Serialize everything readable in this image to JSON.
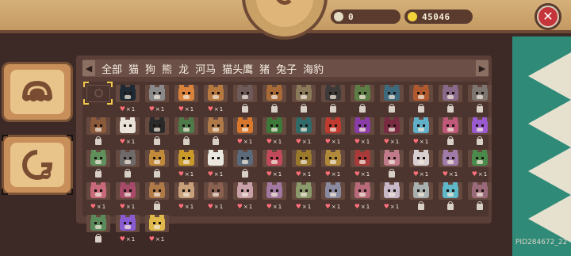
{
  "currency": {
    "gems": "0",
    "coins": "45046",
    "gem_color": "#e3dcc2",
    "coin_color": "#f2d13b"
  },
  "filters": [
    "全部",
    "猫",
    "狗",
    "熊",
    "龙",
    "河马",
    "猫头鹰",
    "猪",
    "兔子",
    "海豹"
  ],
  "footer": {
    "pid": "PID284672_22"
  },
  "grid": [
    {
      "type": "search",
      "color": "#4b352e",
      "count": ""
    },
    {
      "type": "animal",
      "color": "#1e2a33",
      "count": "1"
    },
    {
      "type": "animal",
      "color": "#8a8a8a",
      "count": "1"
    },
    {
      "type": "animal",
      "color": "#d9823b",
      "count": "1"
    },
    {
      "type": "animal",
      "color": "#b7793f",
      "count": "1"
    },
    {
      "type": "animal",
      "color": "#6e5b59",
      "count": ""
    },
    {
      "type": "animal",
      "color": "#a86b38",
      "count": ""
    },
    {
      "type": "animal",
      "color": "#8a7a5a",
      "count": ""
    },
    {
      "type": "animal",
      "color": "#3e3a3a",
      "count": ""
    },
    {
      "type": "animal",
      "color": "#5c7d45",
      "count": ""
    },
    {
      "type": "animal",
      "color": "#3d6a7d",
      "count": ""
    },
    {
      "type": "animal",
      "color": "#b0582e",
      "count": ""
    },
    {
      "type": "animal",
      "color": "#8a6a8a",
      "count": ""
    },
    {
      "type": "animal",
      "color": "#7d7670",
      "count": ""
    },
    {
      "type": "animal",
      "color": "#8b5a3a",
      "count": ""
    },
    {
      "type": "animal",
      "color": "#e8e2d8",
      "count": "1"
    },
    {
      "type": "animal",
      "color": "#2a2a2a",
      "count": ""
    },
    {
      "type": "animal",
      "color": "#4f7a4a",
      "count": ""
    },
    {
      "type": "animal",
      "color": "#b07a48",
      "count": ""
    },
    {
      "type": "animal",
      "color": "#d9772d",
      "count": "1"
    },
    {
      "type": "animal",
      "color": "#3d7a3a",
      "count": "1"
    },
    {
      "type": "animal",
      "color": "#2f6b6a",
      "count": "1"
    },
    {
      "type": "animal",
      "color": "#c03a30",
      "count": "1"
    },
    {
      "type": "animal",
      "color": "#8a3da8",
      "count": "1"
    },
    {
      "type": "animal",
      "color": "#7a2a40",
      "count": "1"
    },
    {
      "type": "animal",
      "color": "#5fb0c8",
      "count": "1"
    },
    {
      "type": "animal",
      "color": "#c0587a",
      "count": ""
    },
    {
      "type": "animal",
      "color": "#9a5ad0",
      "count": ""
    },
    {
      "type": "animal",
      "color": "#5f8f5a",
      "count": ""
    },
    {
      "type": "animal",
      "color": "#6f6a6a",
      "count": ""
    },
    {
      "type": "animal",
      "color": "#c08a3a",
      "count": ""
    },
    {
      "type": "animal",
      "color": "#c99a2a",
      "count": "1"
    },
    {
      "type": "animal",
      "color": "#e8e8e0",
      "count": "1"
    },
    {
      "type": "animal",
      "color": "#5a6a7a",
      "count": ""
    },
    {
      "type": "animal",
      "color": "#c04a5a",
      "count": "1"
    },
    {
      "type": "animal",
      "color": "#9a7a2a",
      "count": "1"
    },
    {
      "type": "animal",
      "color": "#b08a3a",
      "count": "1"
    },
    {
      "type": "animal",
      "color": "#a83a3a",
      "count": "1"
    },
    {
      "type": "animal",
      "color": "#c07a8a",
      "count": ""
    },
    {
      "type": "animal",
      "color": "#d8d0d0",
      "count": "1"
    },
    {
      "type": "animal",
      "color": "#a07aa8",
      "count": "1"
    },
    {
      "type": "animal",
      "color": "#4a8a4a",
      "count": "1"
    },
    {
      "type": "animal",
      "color": "#c86a7a",
      "count": "1"
    },
    {
      "type": "animal",
      "color": "#a84a6a",
      "count": "1"
    },
    {
      "type": "animal",
      "color": "#b07a48",
      "count": ""
    },
    {
      "type": "animal",
      "color": "#c8a07a",
      "count": "1"
    },
    {
      "type": "animal",
      "color": "#8a6050",
      "count": "1"
    },
    {
      "type": "animal",
      "color": "#c8a0a8",
      "count": "1"
    },
    {
      "type": "animal",
      "color": "#a078a0",
      "count": "1"
    },
    {
      "type": "animal",
      "color": "#8a9a6a",
      "count": "1"
    },
    {
      "type": "animal",
      "color": "#8a8aa0",
      "count": "1"
    },
    {
      "type": "animal",
      "color": "#b86a7a",
      "count": "1"
    },
    {
      "type": "animal",
      "color": "#c8b8c8",
      "count": "1"
    },
    {
      "type": "animal",
      "color": "#a8b0b0",
      "count": ""
    },
    {
      "type": "animal",
      "color": "#5fb8c8",
      "count": ""
    },
    {
      "type": "animal",
      "color": "#9a6a7a",
      "count": ""
    },
    {
      "type": "animal",
      "color": "#5a8a5a",
      "count": ""
    },
    {
      "type": "animal",
      "color": "#8a5ad0",
      "count": "1"
    },
    {
      "type": "animal",
      "color": "#e0b84a",
      "count": "1"
    }
  ]
}
